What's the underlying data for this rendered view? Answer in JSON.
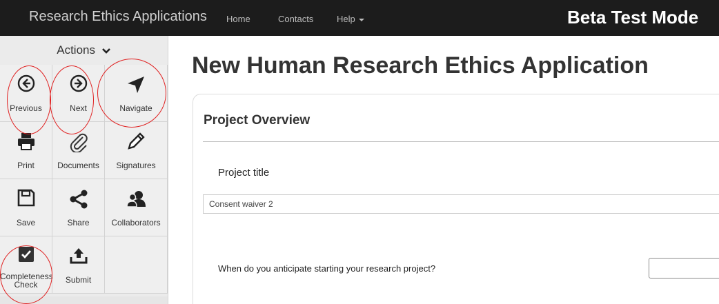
{
  "navbar": {
    "brand": "Research Ethics Applications",
    "links": [
      "Home",
      "Contacts",
      "Help"
    ],
    "mode_banner": "Beta Test Mode"
  },
  "sidebar": {
    "actions_label": "Actions",
    "tiles": [
      {
        "label": "Previous",
        "icon": "arrow-left-circle-icon"
      },
      {
        "label": "Next",
        "icon": "arrow-right-circle-icon"
      },
      {
        "label": "Navigate",
        "icon": "location-arrow-icon"
      },
      {
        "label": "Print",
        "icon": "printer-icon"
      },
      {
        "label": "Documents",
        "icon": "paperclip-icon"
      },
      {
        "label": "Signatures",
        "icon": "pencil-icon"
      },
      {
        "label": "Save",
        "icon": "floppy-disk-icon"
      },
      {
        "label": "Share",
        "icon": "share-icon"
      },
      {
        "label": "Collaborators",
        "icon": "users-icon"
      },
      {
        "label": "Completeness Check",
        "icon": "checkbox-icon"
      },
      {
        "label": "Submit",
        "icon": "upload-icon"
      }
    ]
  },
  "main": {
    "page_title": "New Human Research Ethics Application",
    "panel_title": "Project Overview",
    "project_title_label": "Project title",
    "project_title_value": "Consent waiver 2",
    "start_question": "When do you anticipate starting your research project?"
  },
  "colors": {
    "navbar_bg": "#1c1c1c",
    "sidebar_bg": "#ebebeb",
    "annotation": "#e02020"
  }
}
